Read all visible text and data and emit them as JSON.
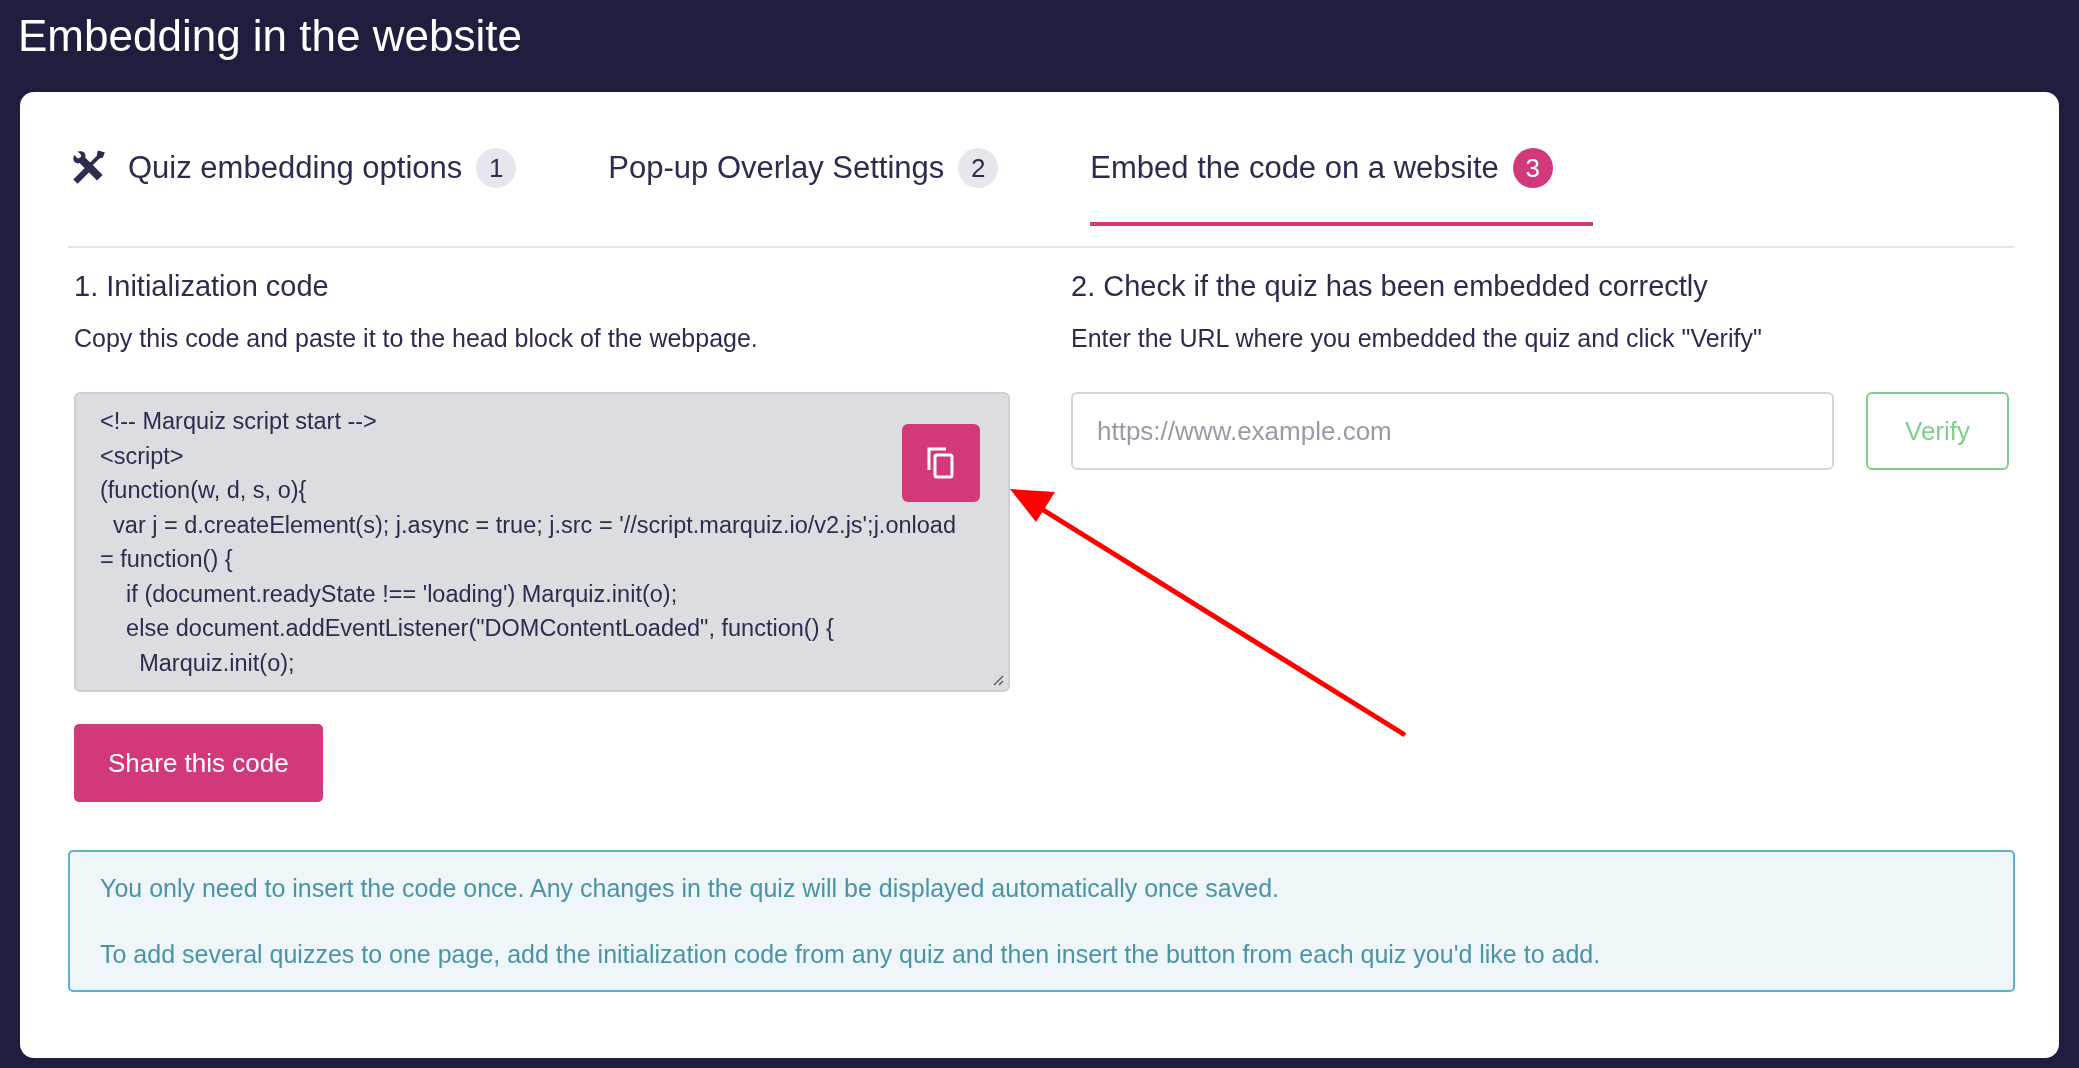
{
  "page": {
    "title": "Embedding in the website"
  },
  "tabs": [
    {
      "label": "Quiz embedding options",
      "count": "1",
      "selected": false
    },
    {
      "label": "Pop-up Overlay Settings",
      "count": "2",
      "selected": false
    },
    {
      "label": "Embed the code on a website",
      "count": "3",
      "selected": true
    }
  ],
  "init_section": {
    "heading": "1. Initialization code",
    "description": "Copy this code and paste it to the head block of the webpage.",
    "code_lines": [
      "<!-- Marquiz script start -->",
      "<script>",
      "(function(w, d, s, o){",
      "  var j = d.createElement(s); j.async = true; j.src = '//script.marquiz.io/v2.js';j.onload",
      "= function() {",
      "    if (document.readyState !== 'loading') Marquiz.init(o);",
      "    else document.addEventListener(\"DOMContentLoaded\", function() {",
      "      Marquiz.init(o);"
    ],
    "share_button": "Share this code"
  },
  "verify_section": {
    "heading": "2. Check if the quiz has been embedded correctly",
    "description": "Enter the URL where you embedded the quiz and click \"Verify\"",
    "url_field": {
      "placeholder": "https://www.example.com"
    },
    "verify_button": "Verify"
  },
  "info_box": [
    "You only need to insert the code once. Any changes in the quiz will be displayed automatically once saved.",
    "To add several quizzes to one page, add the initialization code from any quiz and then insert the button from each quiz you'd like to add."
  ]
}
